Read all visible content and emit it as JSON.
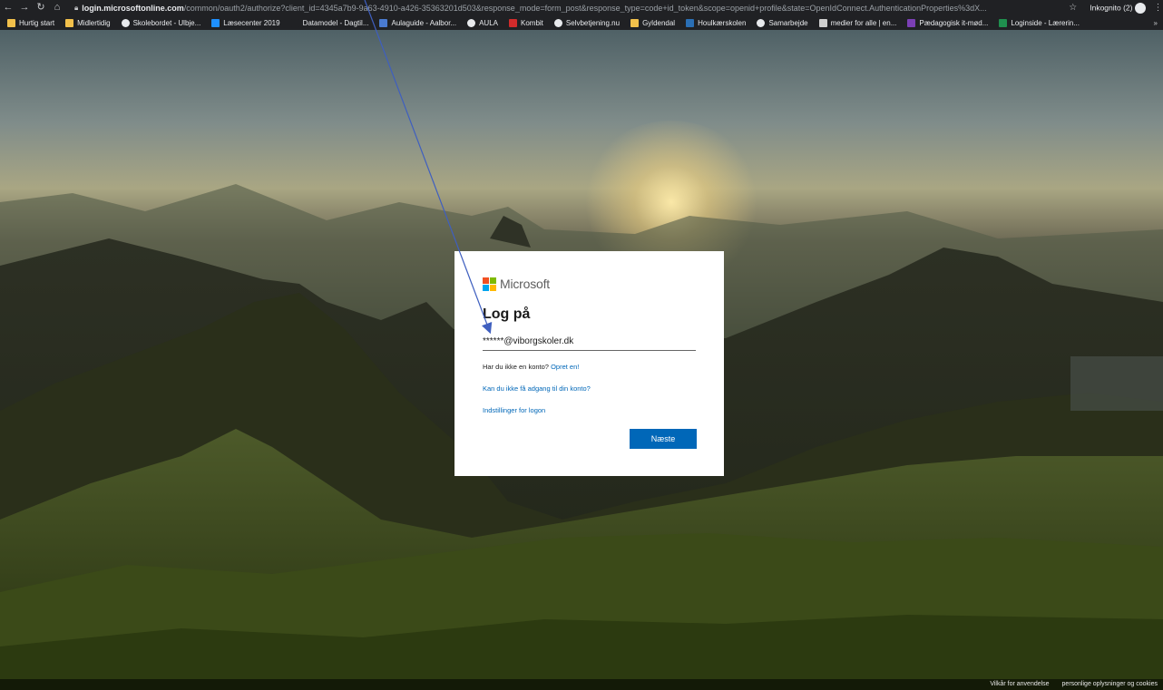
{
  "browser": {
    "url_host": "login.microsoftonline.com",
    "url_path": "/common/oauth2/authorize?client_id=4345a7b9-9a63-4910-a426-35363201d503&response_mode=form_post&response_type=code+id_token&scope=openid+profile&state=OpenIdConnect.AuthenticationProperties%3dX...",
    "incognito_label": "Inkognito (2)"
  },
  "bookmarks": [
    {
      "label": "Hurtig start",
      "icon": "folder-icon",
      "color": "#f2c04b"
    },
    {
      "label": "Midlertidig",
      "icon": "folder-icon",
      "color": "#f2c04b"
    },
    {
      "label": "Skolebordet - Ulbje...",
      "icon": "globe-icon",
      "color": "#e8eaed"
    },
    {
      "label": "Læsecenter 2019",
      "icon": "onedrive-icon",
      "color": "#1e90ff"
    },
    {
      "label": "Datamodel - Dagtil...",
      "icon": "blank-icon",
      "color": "#202124"
    },
    {
      "label": "Aulaguide - Aalbor...",
      "icon": "calendar-icon",
      "color": "#4a7bd0"
    },
    {
      "label": "AULA",
      "icon": "globe-icon",
      "color": "#e8eaed"
    },
    {
      "label": "Kombit",
      "icon": "k-icon",
      "color": "#d12b2b"
    },
    {
      "label": "Selvbetjening.nu",
      "icon": "globe-icon",
      "color": "#e8eaed"
    },
    {
      "label": "Gyldendal",
      "icon": "folder-icon",
      "color": "#f2c04b"
    },
    {
      "label": "Houlkærskolen",
      "icon": "sharepoint-icon",
      "color": "#2a6fb5"
    },
    {
      "label": "Samarbejde",
      "icon": "globe-icon",
      "color": "#e8eaed"
    },
    {
      "label": "medier for alle | en...",
      "icon": "media-icon",
      "color": "#cfcfcf"
    },
    {
      "label": "Pædagogisk it-mød...",
      "icon": "onenote-icon",
      "color": "#7b3fb5"
    },
    {
      "label": "Loginside - Lærerin...",
      "icon": "si-icon",
      "color": "#1f8f4e"
    }
  ],
  "login": {
    "brand": "Microsoft",
    "title": "Log på",
    "email_value": "******@viborgskoler.dk",
    "no_account_text": "Har du ikke en konto?",
    "create_link": "Opret en!",
    "cant_access_link": "Kan du ikke få adgang til din konto?",
    "signin_options_link": "Indstillinger for logon",
    "next_button": "Næste"
  },
  "footer": {
    "terms": "Vilkår for anvendelse",
    "privacy": "personlige oplysninger og cookies"
  },
  "colors": {
    "ms_red": "#f25022",
    "ms_green": "#7fba00",
    "ms_blue": "#00a4ef",
    "ms_yellow": "#ffb900",
    "accent": "#0067b8"
  }
}
